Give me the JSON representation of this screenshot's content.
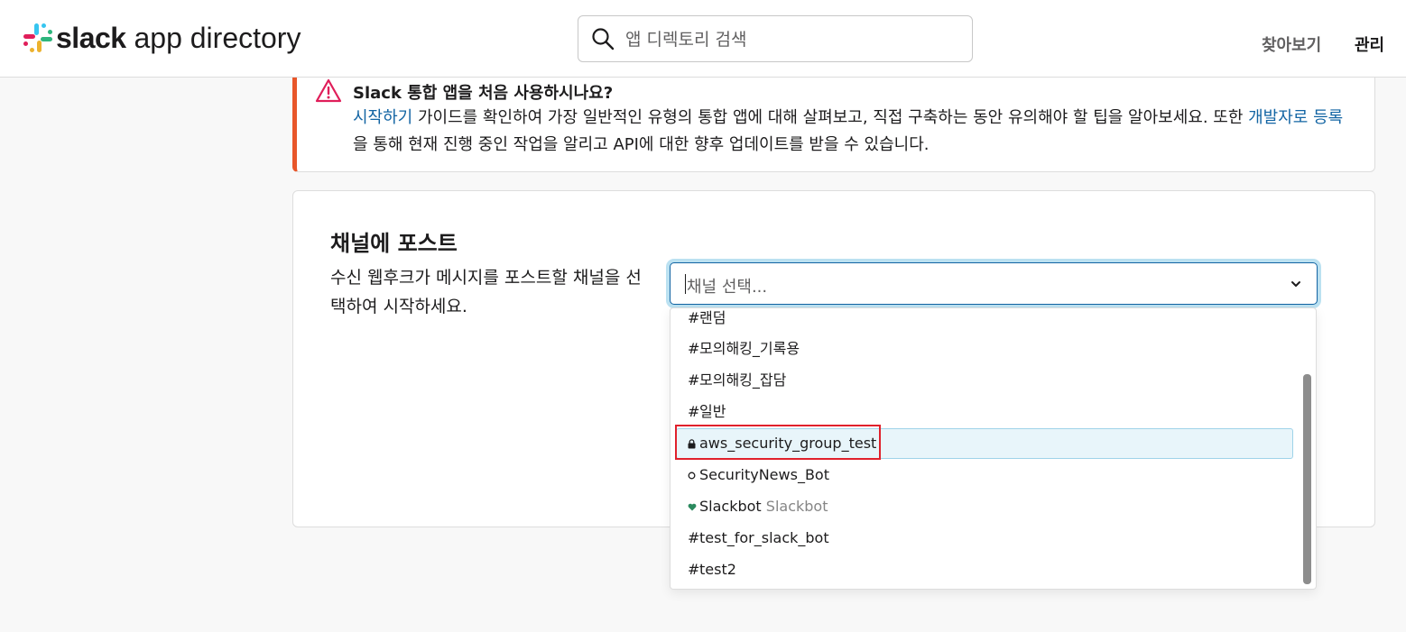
{
  "header": {
    "brand_bold": "slack",
    "brand_rest": " app directory",
    "search_placeholder": "앱 디렉토리 검색",
    "nav_browse": "찾아보기",
    "nav_manage": "관리"
  },
  "alert": {
    "title": "Slack 통합 앱을 처음 사용하시나요?",
    "link_getting_started": "시작하기",
    "text_part1": " 가이드를 확인하여 가장 일반적인 유형의 통합 앱에 대해 살펴보고, 직접 구축하는 동안 유의해야 할 팁을 알아보세요. 또한 ",
    "link_register": "개발자로 등록",
    "text_part2": "을 통해 현재 진행 중인 작업을 알리고 API에 대한 향후 업데이트를 받을 수 있습니다.",
    "accent_color": "#e8562a"
  },
  "card": {
    "title": "채널에 포스트",
    "description": "수신 웹후크가 메시지를 포스트할 채널을 선택하여 시작하세요."
  },
  "select": {
    "placeholder": "채널 선택..."
  },
  "channels": [
    {
      "prefix": "#",
      "label": "랜덤",
      "sub": ""
    },
    {
      "prefix": "#",
      "label": "모의해킹_기록용",
      "sub": ""
    },
    {
      "prefix": "#",
      "label": "모의해킹_잡담",
      "sub": ""
    },
    {
      "prefix": "#",
      "label": "일반",
      "sub": ""
    },
    {
      "prefix": "lock-icon",
      "label": "aws_security_group_test",
      "sub": ""
    },
    {
      "prefix": "status-circle-icon",
      "label": "SecurityNews_Bot",
      "sub": ""
    },
    {
      "prefix": "heart-icon",
      "label": "Slackbot",
      "sub": "Slackbot"
    },
    {
      "prefix": "#",
      "label": "test_for_slack_bot",
      "sub": ""
    },
    {
      "prefix": "#",
      "label": "test2",
      "sub": ""
    }
  ],
  "highlight_color": "#e0212c"
}
